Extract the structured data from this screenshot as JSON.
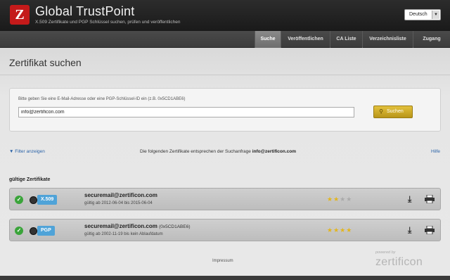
{
  "header": {
    "logo_letter": "Z",
    "title": "Global TrustPoint",
    "subtitle": "X.509 Zertifikate und PGP Schlüssel suchen, prüfen und veröffentlichen",
    "language": "Deutsch"
  },
  "nav": {
    "items": [
      {
        "label": "Suche",
        "active": true
      },
      {
        "label": "Veröffentlichen",
        "active": false
      },
      {
        "label": "CA Liste",
        "active": false
      },
      {
        "label": "Verzeichnisliste",
        "active": false
      },
      {
        "label": "Zugang",
        "active": false
      }
    ]
  },
  "main": {
    "title": "Zertifikat suchen",
    "hint": "Bitte geben Sie eine E-Mail-Adresse oder eine PGP-Schlüssel-ID ein (z.B. 0x5CD1ABE6)",
    "search_value": "info@zertificon.com",
    "search_button": "Suchen",
    "filter_link": "Filter anzeigen",
    "result_prefix": "Die folgenden Zertifikate entsprechen der Suchanfrage",
    "result_query": "info@zertificon.com",
    "help_link": "Hilfe",
    "section_title": "gültige Zertifikate"
  },
  "certificates": [
    {
      "type": "X.509",
      "email": "securemail@zertificon.com",
      "key_id": "",
      "validity": "gültig ab 2012-06-04 bis 2015-06-04",
      "rating": 2,
      "rating_max": 4
    },
    {
      "type": "PGP",
      "email": "securemail@zertificon.com",
      "key_id": "(0x5CD1ABE6)",
      "validity": "gültig ab 2002-11-19 bis kein Ablaufdatum",
      "rating": 4,
      "rating_max": 4
    }
  ],
  "footer": {
    "impressum": "Impressum",
    "powered_by": "powered by",
    "brand": "zertificon"
  },
  "colors": {
    "accent_red": "#c41a1a",
    "search_button": "#d4ae2a",
    "badge_blue": "#4fa3d8",
    "check_green": "#3aa43a",
    "star": "#e3b51c"
  }
}
